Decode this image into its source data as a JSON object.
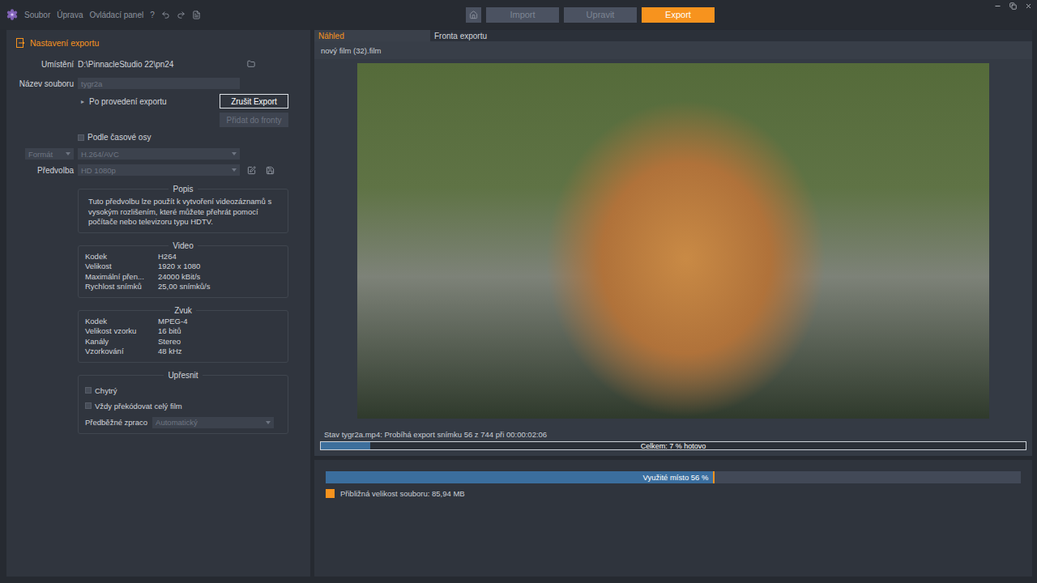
{
  "window": {
    "menu": [
      {
        "label": "Soubor"
      },
      {
        "label": "Úprava"
      },
      {
        "label": "Ovládací panel"
      }
    ],
    "help": "?",
    "nav": [
      {
        "label": "Import",
        "selected": false
      },
      {
        "label": "Upravit",
        "selected": false
      },
      {
        "label": "Export",
        "selected": true
      }
    ]
  },
  "export_settings": {
    "title": "Nastavení exportu",
    "location": {
      "label": "Umístění",
      "value": "D:\\PinnacleStudio 22\\pn24"
    },
    "file_name": {
      "label": "Název souboru",
      "value": "tygr2a",
      "disabled": true
    },
    "after_export": {
      "marker": "▸",
      "label": "Po provedení exportu",
      "expanded": false
    },
    "buttons": [
      {
        "label": "Zrušit Export",
        "disabled": false,
        "focused": true
      },
      {
        "label": "Přidat do fronty",
        "disabled": true,
        "focused": false
      }
    ],
    "timeline_checkbox": {
      "label": "Podle časové osy",
      "checked": false
    },
    "format": {
      "type": "Formát",
      "value": "H.264/AVC",
      "disabled": true
    },
    "preset": {
      "label": "Předvolba",
      "value": "HD 1080p",
      "disabled": true
    },
    "description": {
      "title": "Popis",
      "text": "Tuto předvolbu lze použít k vytvoření videozáznamů s vysokým rozlišením, které můžete přehrát pomocí počítače nebo televizoru typu HDTV."
    },
    "video": {
      "title": "Video",
      "rows": [
        {
          "label": "Kodek",
          "value": "H264"
        },
        {
          "label": "Velikost",
          "value": "1920 x 1080"
        },
        {
          "label": "Maximální přen...",
          "value": "24000 kBit/s"
        },
        {
          "label": "Rychlost snímků",
          "value": "25,00 snímků/s"
        }
      ]
    },
    "audio": {
      "title": "Zvuk",
      "rows": [
        {
          "label": "Kodek",
          "value": "MPEG-4"
        },
        {
          "label": "Velikost vzorku",
          "value": "16 bitů"
        },
        {
          "label": "Kanály",
          "value": "Stereo"
        },
        {
          "label": "Vzorkování",
          "value": "48 kHz"
        }
      ]
    },
    "refine": {
      "title": "Upřesnit",
      "checkboxes": [
        {
          "label": "Chytrý",
          "checked": false
        },
        {
          "label": "Vždy překódovat celý film",
          "checked": false
        }
      ],
      "preprocess": {
        "label": "Předběžné zpraco",
        "value": "Automatický",
        "disabled": true
      }
    }
  },
  "preview": {
    "tabs": [
      {
        "label": "Náhled",
        "selected": true
      },
      {
        "label": "Fronta exportu",
        "selected": false
      }
    ],
    "project": "nový film (32).film",
    "status": "Stav tygr2a.mp4: Probíhá export snímku 56 z 744 při 00:00:02:06",
    "progress": {
      "label": "Celkem: 7 % hotovo",
      "level": 0.07
    }
  },
  "disk": {
    "label": "Využité místo 56 %",
    "level": 0.56,
    "legend": [
      {
        "label": "Přibližná velikost souboru: 85,94 MB",
        "color": "#f7931e"
      }
    ]
  }
}
